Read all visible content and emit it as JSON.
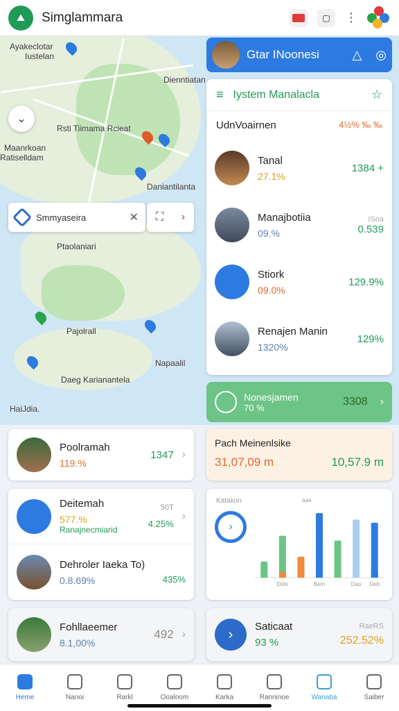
{
  "app": {
    "title": "Simglammara"
  },
  "map": {
    "labels": [
      "Ayakeclotar",
      "Iustelan",
      "Dienntiatan",
      "Rsti Tiimama Rcieat",
      "Maanrkoan",
      "Ratiselldam",
      "Daniantilanta",
      "Ptaolaniari",
      "Pajolrall",
      "Napaalil",
      "Daeg Karianantela",
      "HaiJdia."
    ],
    "search_chip": "Smmyaseira"
  },
  "right_header": {
    "title": "Gtar INoonesi"
  },
  "panel": {
    "title": "Iystem Manalacla",
    "sub_label": "UdnVoairnen",
    "sub_value": "4½% ‰ ‰",
    "rows": [
      {
        "name": "Tanal",
        "pct": "27.1%",
        "pct_color": "#e0a11b",
        "right": "1384 +",
        "right_color": "#1f9a57",
        "right_top": ""
      },
      {
        "name": "Manajbotiia",
        "pct": "09.%",
        "pct_color": "#5a7fb0",
        "right": "0.539",
        "right_color": "#1f9a57",
        "right_top": "ISoa"
      },
      {
        "name": "Stiork",
        "pct": "09.0%",
        "pct_color": "#e06b2b",
        "right": "129.9%",
        "right_color": "#1f9a57",
        "right_top": ""
      },
      {
        "name": "Renajen Manin",
        "pct": "1320%",
        "pct_color": "#5a7fb0",
        "right": "129%",
        "right_color": "#1f9a57",
        "right_top": ""
      }
    ]
  },
  "green_banner": {
    "line1": "Nonesjamen",
    "line2": "70 %",
    "value": "3308"
  },
  "left_cards": {
    "c1": {
      "name": "Poolramah",
      "pct": "119.%",
      "right": "1347"
    },
    "c2a": {
      "name": "Deitemah",
      "pct": "577.%",
      "sub": "Ranajnecmiarid",
      "right_top": "50T",
      "right": "4.25%"
    },
    "c2b": {
      "name": "Dehroler Iaeka To)",
      "pct": "0.8.69%",
      "right": "435%"
    },
    "c3": {
      "name": "Fohllaeemer",
      "pct": "8.1,00%",
      "right": "492"
    }
  },
  "peach_card": {
    "title": "Pach Meinenlsike",
    "left_value": "31,07,09 m",
    "right_value": "10,57.9 m"
  },
  "small_chart": {
    "label_tl": "Katakon",
    "label_top": "aaa"
  },
  "chart_data": {
    "type": "bar",
    "categories": [
      "",
      "",
      "",
      "",
      "",
      "",
      ""
    ],
    "series": [
      {
        "name": "",
        "values": [
          1.0,
          2.6,
          1.3,
          4.0,
          2.3,
          3.6,
          3.4
        ]
      }
    ],
    "ylim": [
      0,
      4.3
    ],
    "colors": [
      "#6cc486",
      "#6cc486",
      "#f08a3c",
      "#2d7be0",
      "#6cc486",
      "#a9cfee",
      "#2d7be0"
    ],
    "bottom_colors": [
      "#6cc486",
      "#f08a3c",
      "#f08a3c",
      "#2d7be0",
      "#6cc486",
      "#a9cfee",
      "#2d7be0"
    ],
    "xticklabels": [
      "",
      "Dolo",
      "",
      "Bem",
      "",
      "Dao",
      "Deb"
    ],
    "grid": true
  },
  "stats_card": {
    "title": "Saticaat",
    "left_pct": "93 %",
    "right_top": "RaeRS",
    "right_value": "252.52%"
  },
  "nav": [
    {
      "label": "Heme",
      "active": true
    },
    {
      "label": "Nanoi",
      "active": false
    },
    {
      "label": "Rarkl",
      "active": false
    },
    {
      "label": "Ooaloom",
      "active": false
    },
    {
      "label": "Karka",
      "active": false
    },
    {
      "label": "Ranninoe",
      "active": false
    },
    {
      "label": "Wanaba",
      "active": true
    },
    {
      "label": "Saiber",
      "active": false
    }
  ]
}
